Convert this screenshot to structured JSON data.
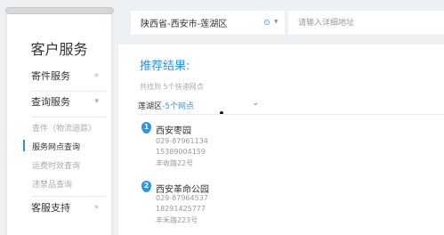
{
  "sidebar": {
    "title": "客户服务",
    "menu": [
      {
        "label": "寄件服务",
        "arrow": "»"
      },
      {
        "label": "查询服务",
        "arrow": "▾"
      },
      {
        "label": "客服支持",
        "arrow": "»"
      }
    ],
    "submenu": [
      {
        "label": "查件（物流追踪）"
      },
      {
        "label": "服务网点查询"
      },
      {
        "label": "运费时效查询"
      },
      {
        "label": "违禁品查询"
      }
    ]
  },
  "search": {
    "region_value": "陕西省-西安市-莲湖区",
    "address_placeholder": "请输入详细地址"
  },
  "results": {
    "title": "推荐结果:",
    "count_text": "共找到 5个快递网点",
    "district": "莲湖区",
    "district_suffix": "-5个网点",
    "outlets": [
      {
        "index": "1",
        "name": "西安枣园",
        "lines": [
          "029-87961134",
          "15389004159",
          "丰收路22号"
        ]
      },
      {
        "index": "2",
        "name": "西安革命公园",
        "lines": [
          "029-87964537",
          "18291425777",
          "丰禾路223号"
        ]
      }
    ]
  },
  "colors": {
    "accent": "#2196f3",
    "background": "#eef1f4"
  }
}
